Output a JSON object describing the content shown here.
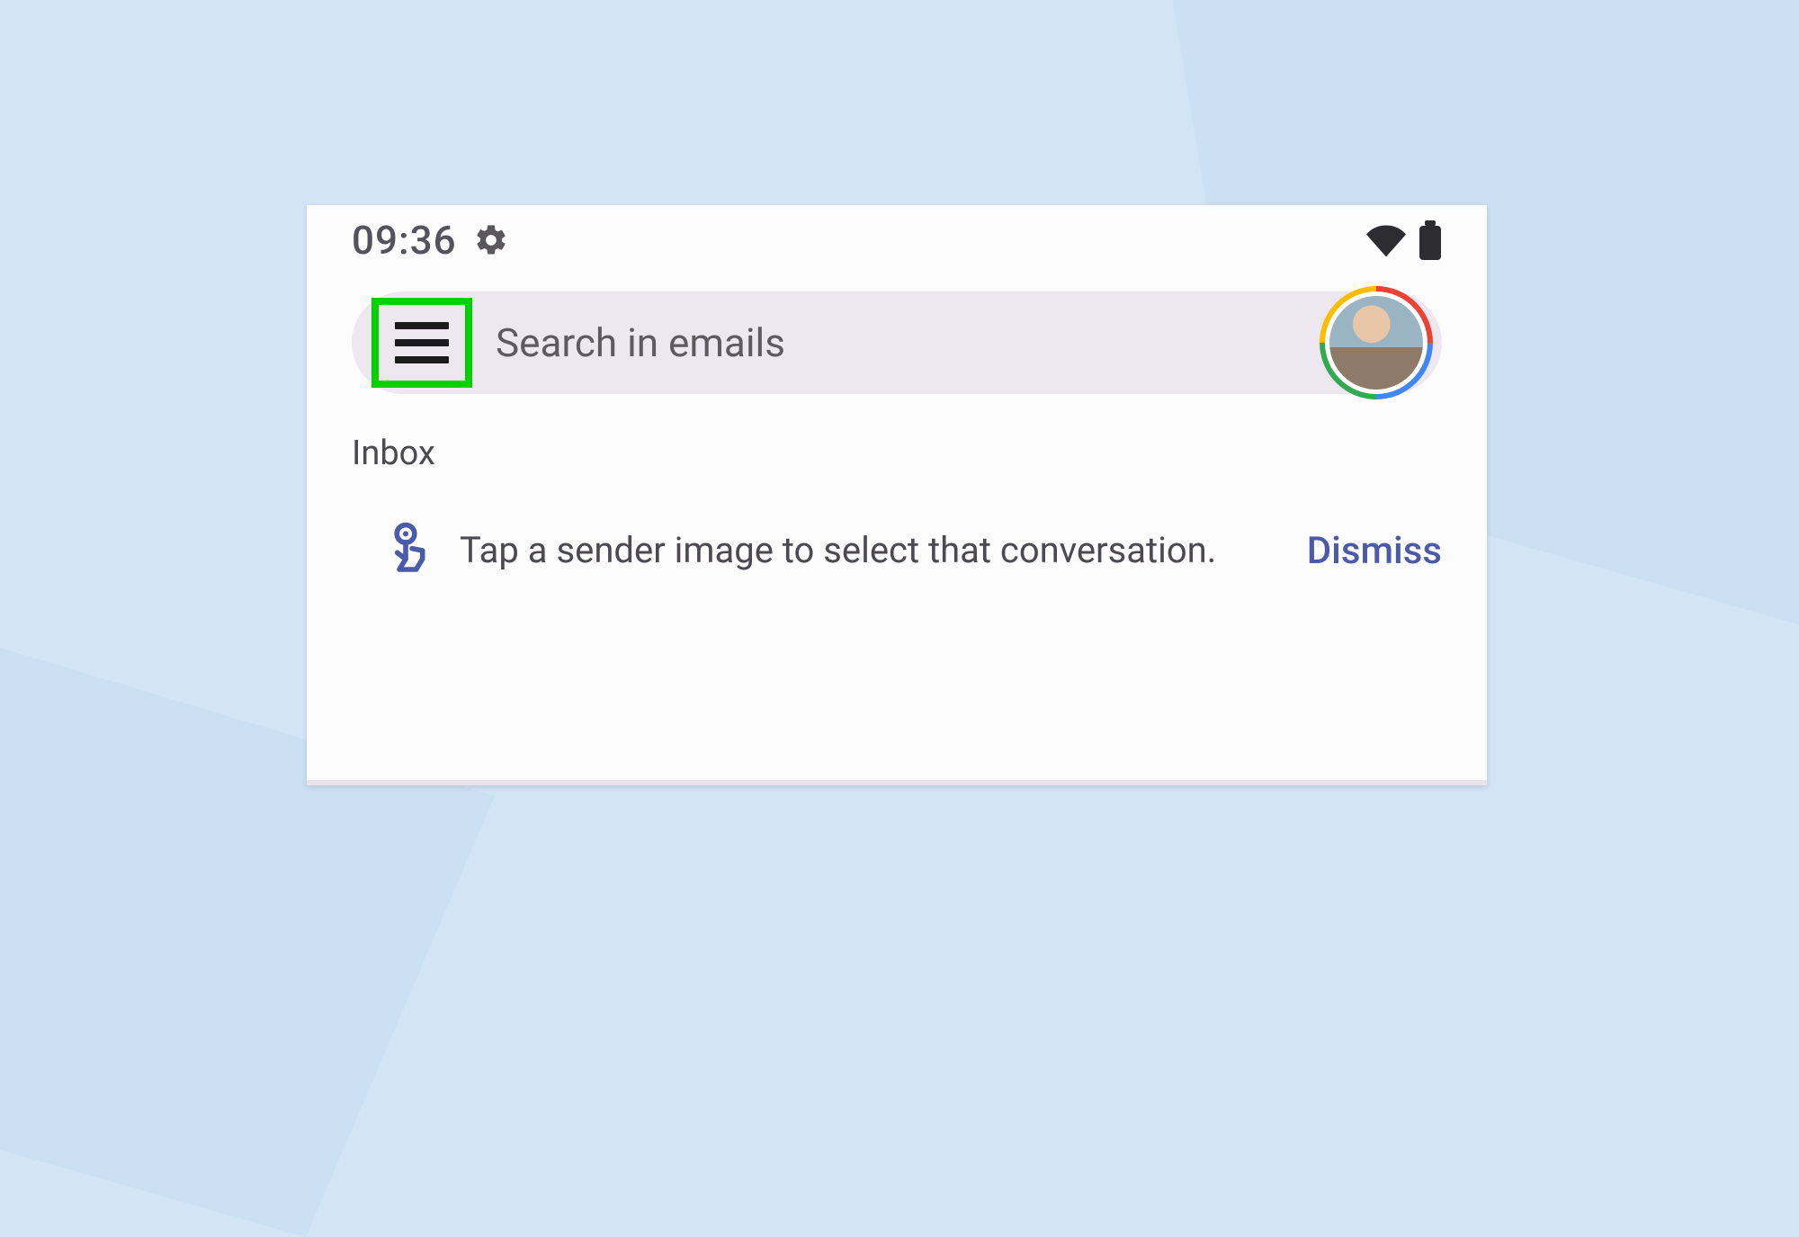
{
  "status": {
    "time": "09:36"
  },
  "search": {
    "placeholder": "Search in emails"
  },
  "inbox": {
    "label": "Inbox"
  },
  "tip": {
    "text": "Tap a sender image to select that conversation.",
    "dismiss_label": "Dismiss"
  },
  "colors": {
    "highlight": "#00d200",
    "accent_link": "#4b5ba7"
  }
}
